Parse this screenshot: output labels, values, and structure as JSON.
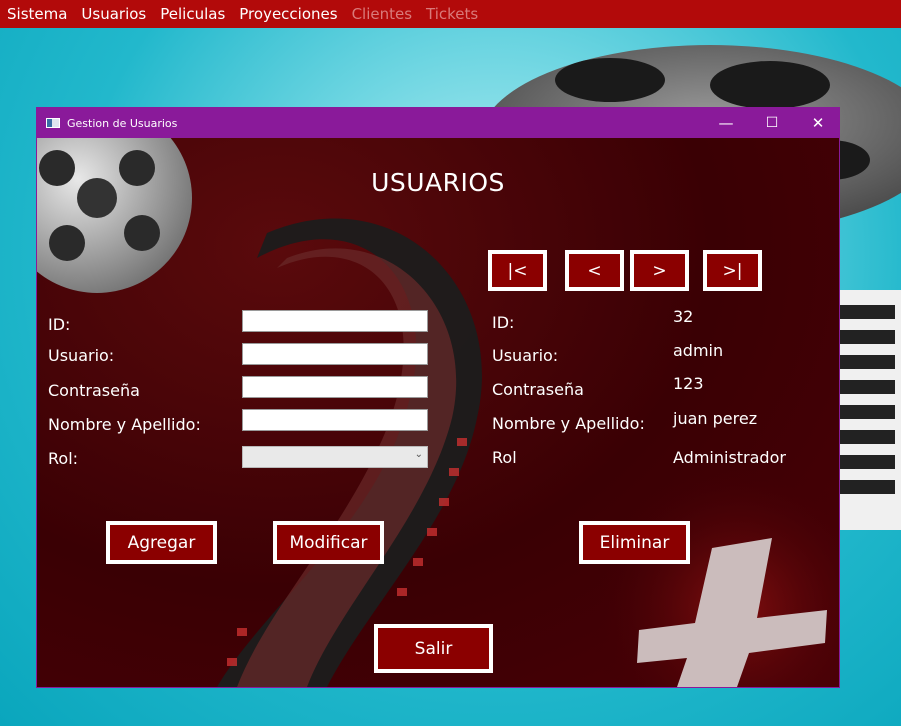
{
  "menu": [
    "Sistema",
    "Usuarios",
    "Peliculas",
    "Proyecciones",
    "Clientes",
    "Tickets"
  ],
  "menu_disabled": [
    false,
    false,
    false,
    false,
    true,
    true
  ],
  "window": {
    "title": "Gestion de Usuarios",
    "minimize": "—",
    "maximize": "☐",
    "close": "✕"
  },
  "heading": "USUARIOS",
  "form": {
    "labels": [
      "ID:",
      "Usuario:",
      "Contraseña",
      "Nombre y Apellido:",
      "Rol:"
    ],
    "id_value": "",
    "usuario_value": "",
    "contrasena_value": "",
    "nombre_value": "",
    "rol_value": ""
  },
  "nav": {
    "first": "|<",
    "prev": "<",
    "next": ">",
    "last": ">|"
  },
  "record": {
    "labels": [
      "ID:",
      "Usuario:",
      "Contraseña",
      "Nombre y Apellido:",
      "Rol"
    ],
    "id": "32",
    "usuario": "admin",
    "contrasena": "123",
    "nombre": "juan perez",
    "rol": "Administrador"
  },
  "buttons": {
    "agregar": "Agregar",
    "modificar": "Modificar",
    "eliminar": "Eliminar",
    "salir": "Salir"
  },
  "colors": {
    "menubar": "#b20a0a",
    "titlebar": "#8a1a9a",
    "button": "#8b0000"
  }
}
